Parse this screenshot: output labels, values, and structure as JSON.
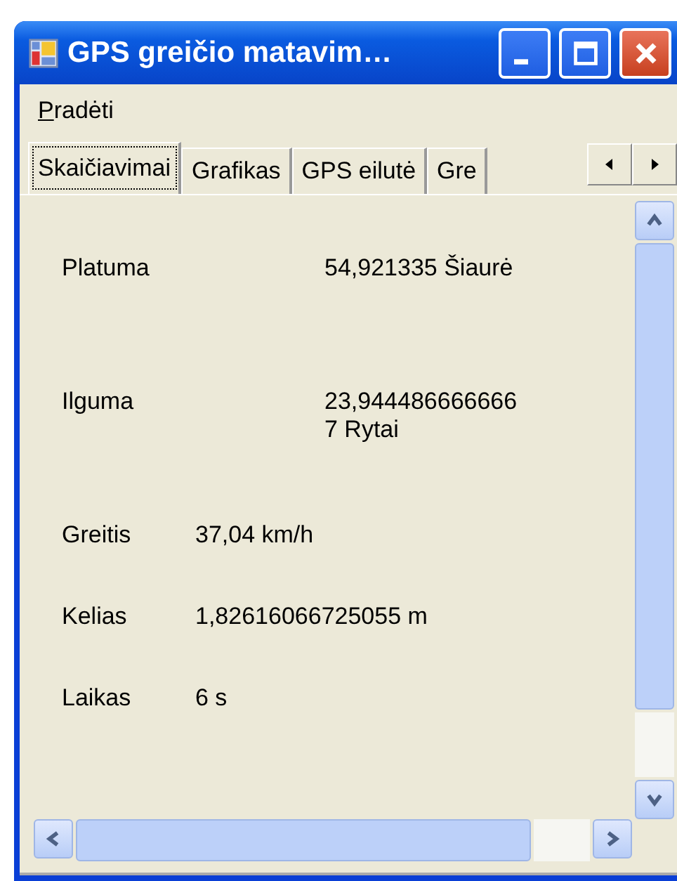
{
  "window": {
    "title": "GPS greičio matavim…"
  },
  "menu": [
    "Pradėti"
  ],
  "tabs": [
    {
      "label": "Skaičiavimai",
      "selected": true
    },
    {
      "label": "Grafikas",
      "selected": false
    },
    {
      "label": "GPS eilutė",
      "selected": false
    },
    {
      "label": "Gre",
      "selected": false
    }
  ],
  "coordinates": [
    {
      "label": "Platuma",
      "value": "54,921335 Šiaurė"
    },
    {
      "label": "Ilguma",
      "value": "23,944486666666 7 Rytai"
    }
  ],
  "measurements": [
    {
      "label": "Greitis",
      "value": "37,04 km/h"
    },
    {
      "label": "Kelias",
      "value": "1,82616066725055 m"
    },
    {
      "label": "Laikas",
      "value": "6 s"
    }
  ]
}
